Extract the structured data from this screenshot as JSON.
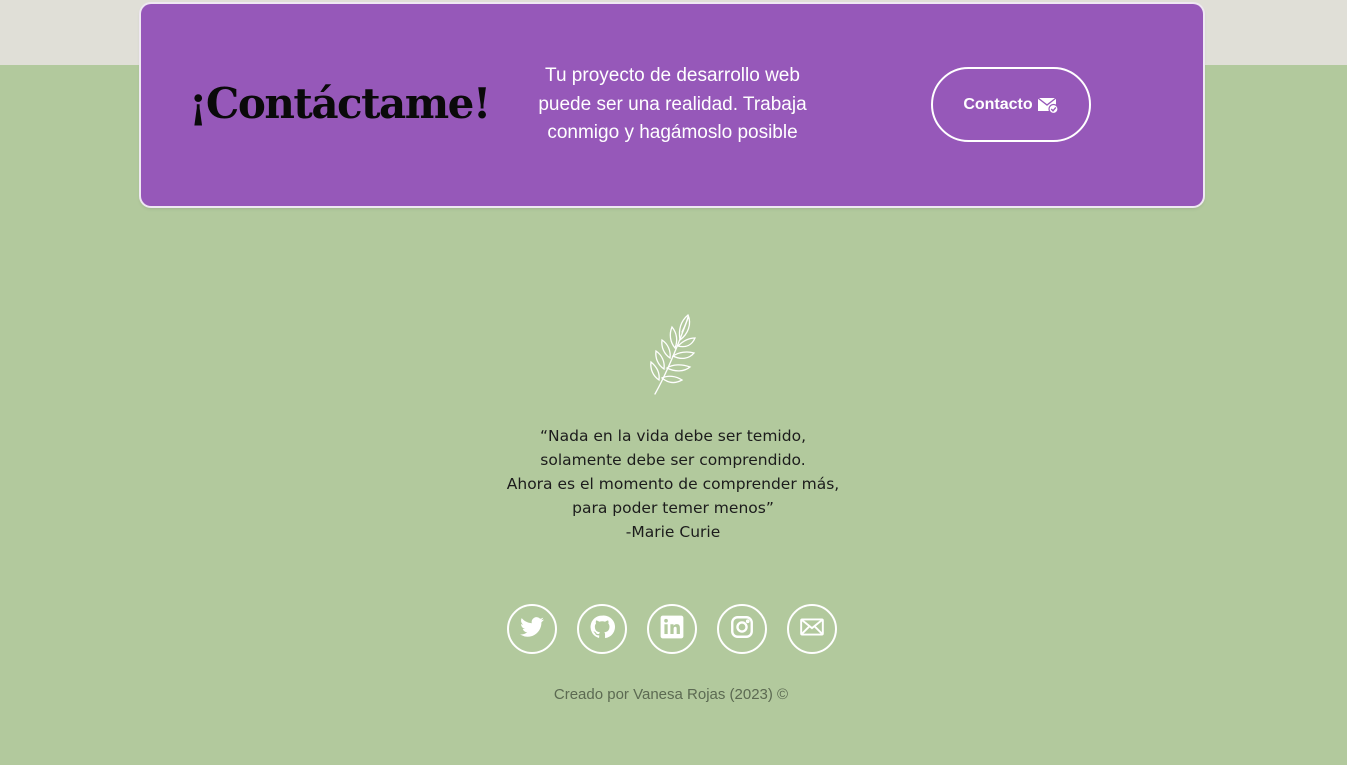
{
  "colors": {
    "background": "#b2c99d",
    "top_band": "#e0dfd7",
    "card": "#9658b9",
    "text_light": "#ffffff",
    "text_dark": "#0a0a0a",
    "credits": "#5c6a52"
  },
  "cta": {
    "title": "¡Contáctame!",
    "lines": [
      "Tu proyecto de desarrollo web",
      "puede ser una realidad. Trabaja",
      "conmigo y hagámoslo posible"
    ],
    "button_label": "Contacto",
    "button_icon": "mail-check-icon"
  },
  "footer": {
    "decoration_icon": "leaf-branch-icon",
    "quote_lines": [
      "“Nada en la vida debe ser temido,",
      "solamente debe ser comprendido.",
      "Ahora es el momento de comprender más,",
      "para poder temer menos”",
      "-Marie Curie"
    ],
    "socials": [
      {
        "name": "twitter",
        "icon": "twitter-icon"
      },
      {
        "name": "github",
        "icon": "github-icon"
      },
      {
        "name": "linkedin",
        "icon": "linkedin-icon"
      },
      {
        "name": "instagram",
        "icon": "instagram-icon"
      },
      {
        "name": "email",
        "icon": "email-icon"
      }
    ],
    "credits": "Creado por Vanesa Rojas (2023) ©"
  }
}
